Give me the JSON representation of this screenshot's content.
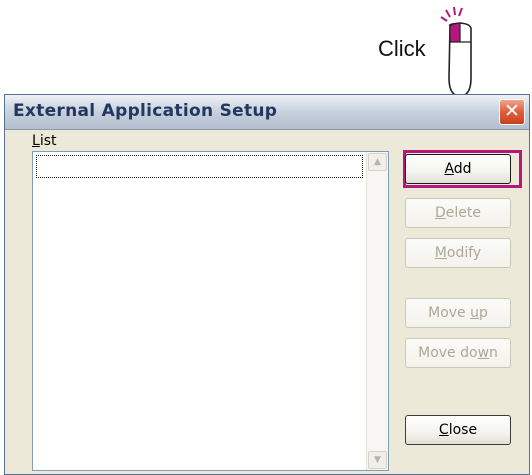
{
  "callout": {
    "label": "Click"
  },
  "dialog": {
    "title": "External Application Setup",
    "close_glyph": "✕",
    "list": {
      "label_accel": "L",
      "label_rest": "ist",
      "items": []
    },
    "buttons": {
      "add": {
        "accel": "A",
        "rest": "dd",
        "enabled": true
      },
      "delete": {
        "accel": "D",
        "rest": "elete",
        "enabled": false
      },
      "modify": {
        "accel": "M",
        "rest": "odify",
        "enabled": false
      },
      "move_up": {
        "pre": "Move ",
        "accel": "u",
        "rest": "p",
        "enabled": false
      },
      "move_down": {
        "pre": "Move do",
        "accel": "w",
        "rest": "n",
        "enabled": false
      },
      "close": {
        "accel": "C",
        "rest": "lose",
        "enabled": true
      }
    }
  },
  "colors": {
    "highlight": "#b5177d",
    "title_text": "#23385f",
    "close_button": "#e05d3a"
  },
  "icons": {
    "mouse": "mouse-icon",
    "close": "close-icon",
    "scroll_up": "scroll-up-arrow-icon",
    "scroll_down": "scroll-down-arrow-icon"
  }
}
